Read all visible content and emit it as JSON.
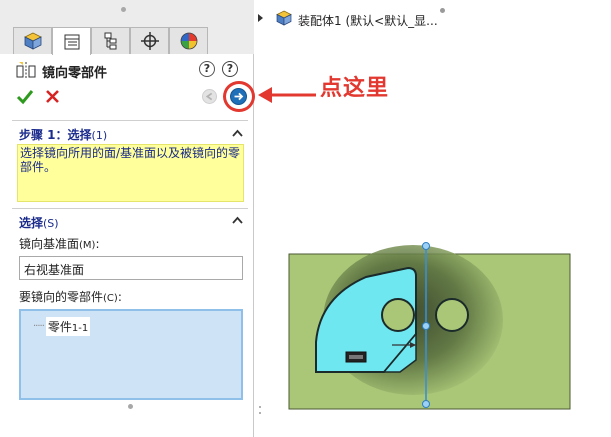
{
  "tabs": [
    {
      "name": "feature-manager",
      "icon": "cube-icon"
    },
    {
      "name": "property-manager",
      "icon": "list-icon",
      "active": true
    },
    {
      "name": "configuration-manager",
      "icon": "tree-icon"
    },
    {
      "name": "dimxpert-manager",
      "icon": "crosshair-icon"
    },
    {
      "name": "display-manager",
      "icon": "color-pie-icon"
    }
  ],
  "property_manager": {
    "title": "镜向零部件",
    "help_icons": [
      "help-whats-new-icon",
      "help-icon"
    ],
    "ok_icon": "check-icon",
    "cancel_icon": "x-icon",
    "prev_icon": "back-arrow-icon",
    "next_icon": "next-arrow-icon"
  },
  "step1": {
    "title": "步骤 1：选择",
    "title_sub": "(1)",
    "message": "选择镜向所用的面/基准面以及被镜向的零部件。"
  },
  "selections": {
    "title": "选择",
    "title_sub": "(S)",
    "plane_label": "镜向基准面",
    "plane_label_sub": "(M)",
    "plane_label_suffix": ":",
    "plane_value": "右视基准面",
    "components_label": "要镜向的零部件",
    "components_label_sub": "(C)",
    "components_label_suffix": ":",
    "components": [
      {
        "name": "零件",
        "suffix": "1-1"
      }
    ]
  },
  "tree": {
    "root_label": "装配体1 (默认<默认_显..."
  },
  "annotation": {
    "text": "点这里",
    "color": "#e2382f"
  },
  "colors": {
    "plate": "#a9c777",
    "part": "#6fe7f0",
    "message_bg": "#ffff9c",
    "list_bg": "#cfe3f6",
    "accent": "#1b2c8c"
  }
}
